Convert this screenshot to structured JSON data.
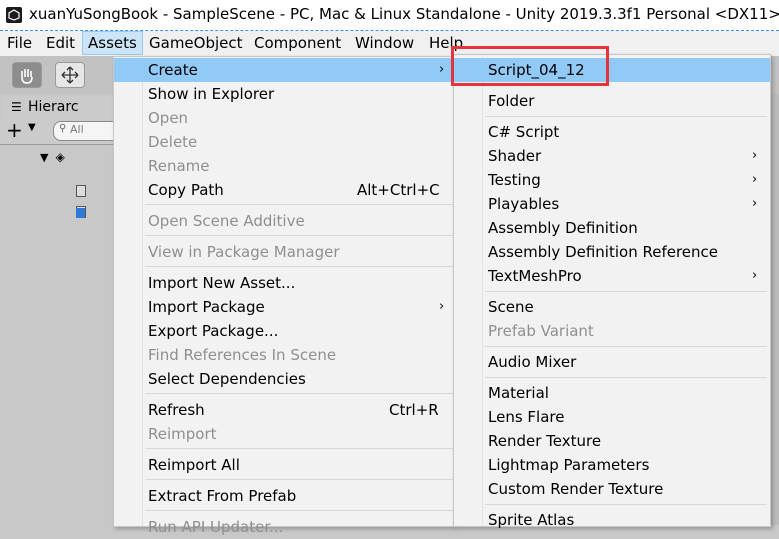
{
  "window": {
    "title": "xuanYuSongBook - SampleScene - PC, Mac & Linux Standalone - Unity 2019.3.3f1 Personal <DX11>"
  },
  "menubar": {
    "items": [
      "File",
      "Edit",
      "Assets",
      "GameObject",
      "Component",
      "Window",
      "Help"
    ]
  },
  "hierarchy": {
    "tab_label": "Hierarc",
    "search_placeholder": "All"
  },
  "assets_menu": {
    "items": [
      {
        "label": "Create",
        "has_submenu": true
      },
      {
        "label": "Show in Explorer"
      },
      {
        "label": "Open",
        "disabled": true
      },
      {
        "label": "Delete",
        "disabled": true
      },
      {
        "label": "Rename",
        "disabled": true
      },
      {
        "label": "Copy Path",
        "shortcut": "Alt+Ctrl+C"
      },
      {
        "label": "Open Scene Additive",
        "disabled": true
      },
      {
        "label": "View in Package Manager",
        "disabled": true
      },
      {
        "label": "Import New Asset..."
      },
      {
        "label": "Import Package",
        "has_submenu": true
      },
      {
        "label": "Export Package..."
      },
      {
        "label": "Find References In Scene",
        "disabled": true
      },
      {
        "label": "Select Dependencies"
      },
      {
        "label": "Refresh",
        "shortcut": "Ctrl+R"
      },
      {
        "label": "Reimport",
        "disabled": true
      },
      {
        "label": "Reimport All"
      },
      {
        "label": "Extract From Prefab"
      },
      {
        "label": "Run API Updater...",
        "disabled": true
      }
    ]
  },
  "create_submenu": {
    "items": [
      {
        "label": "Script_04_12",
        "highlighted": true
      },
      {
        "label": "Folder"
      },
      {
        "label": "C# Script"
      },
      {
        "label": "Shader",
        "has_submenu": true
      },
      {
        "label": "Testing",
        "has_submenu": true
      },
      {
        "label": "Playables",
        "has_submenu": true
      },
      {
        "label": "Assembly Definition"
      },
      {
        "label": "Assembly Definition Reference"
      },
      {
        "label": "TextMeshPro",
        "has_submenu": true
      },
      {
        "label": "Scene"
      },
      {
        "label": "Prefab Variant",
        "disabled": true
      },
      {
        "label": "Audio Mixer"
      },
      {
        "label": "Material"
      },
      {
        "label": "Lens Flare"
      },
      {
        "label": "Render Texture"
      },
      {
        "label": "Lightmap Parameters"
      },
      {
        "label": "Custom Render Texture"
      },
      {
        "label": "Sprite Atlas"
      }
    ]
  },
  "colors": {
    "highlight": "#91c9f7",
    "annotation_box": "#e5343c",
    "menu_bg": "#f2f2f2"
  }
}
